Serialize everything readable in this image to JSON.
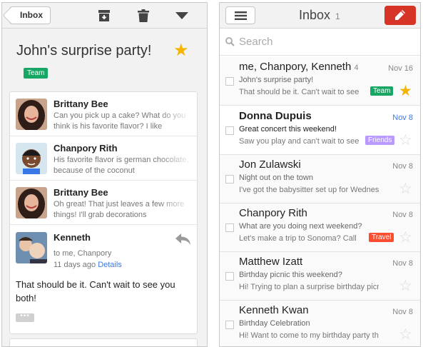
{
  "thread_view": {
    "back_label": "Inbox",
    "subject": "John's surprise party!",
    "label": {
      "text": "Team",
      "color": "#16a765"
    },
    "messages": [
      {
        "from": "Brittany Bee",
        "snippet": "Can you pick up a cake? What do you think is his favorite flavor? I like"
      },
      {
        "from": "Chanpory Rith",
        "snippet": "His favorite flavor is german chocolate, because of the coconut"
      },
      {
        "from": "Brittany Bee",
        "snippet": "Oh great! That just leaves a few more things! I'll grab decorations"
      }
    ],
    "expanded": {
      "from": "Kenneth",
      "to": "to me, Chanpory",
      "time": "11 days ago",
      "details_link": "Details",
      "body": "That should be it. Can't wait to see you both!",
      "more_label": "•••"
    }
  },
  "inbox": {
    "title": "Inbox",
    "count": "1",
    "search_placeholder": "Search",
    "threads": [
      {
        "sender": "me, Chanpory, Kenneth",
        "count": "4",
        "date": "Nov 16",
        "subject": "John's surprise party!",
        "snippet": "That should be it. Can't wait to see",
        "label": "Team",
        "label_color": "#16a765",
        "starred": true,
        "unread": false
      },
      {
        "sender": "Donna Dupuis",
        "count": "",
        "date": "Nov 8",
        "subject": "Great concert this weekend!",
        "snippet": "Saw you play and can't wait to see",
        "label": "Friends",
        "label_color": "#b99aff",
        "starred": false,
        "unread": true
      },
      {
        "sender": "Jon Zulawski",
        "count": "",
        "date": "Nov 8",
        "subject": "Night out on the town",
        "snippet": "I've got the babysitter set up for Wednesday",
        "label": "",
        "label_color": "",
        "starred": false,
        "unread": false
      },
      {
        "sender": "Chanpory Rith",
        "count": "",
        "date": "Nov 8",
        "subject": "What are you doing next weekend?",
        "snippet": "Let's make a trip to Sonoma? Call",
        "label": "Travel",
        "label_color": "#fb4c2f",
        "starred": false,
        "unread": false
      },
      {
        "sender": "Matthew Izatt",
        "count": "",
        "date": "Nov 8",
        "subject": "Birthday picnic this weekend?",
        "snippet": "Hi! Trying to plan a surprise birthday picnic",
        "label": "",
        "label_color": "",
        "starred": false,
        "unread": false
      },
      {
        "sender": "Kenneth Kwan",
        "count": "",
        "date": "Nov 8",
        "subject": "Birthday Celebration",
        "snippet": "Hi! Want to come to my birthday party this",
        "label": "",
        "label_color": "",
        "starred": false,
        "unread": false
      }
    ]
  },
  "colors": {
    "compose": "#d63426",
    "link": "#3b78e7",
    "star": "#f4b400"
  }
}
